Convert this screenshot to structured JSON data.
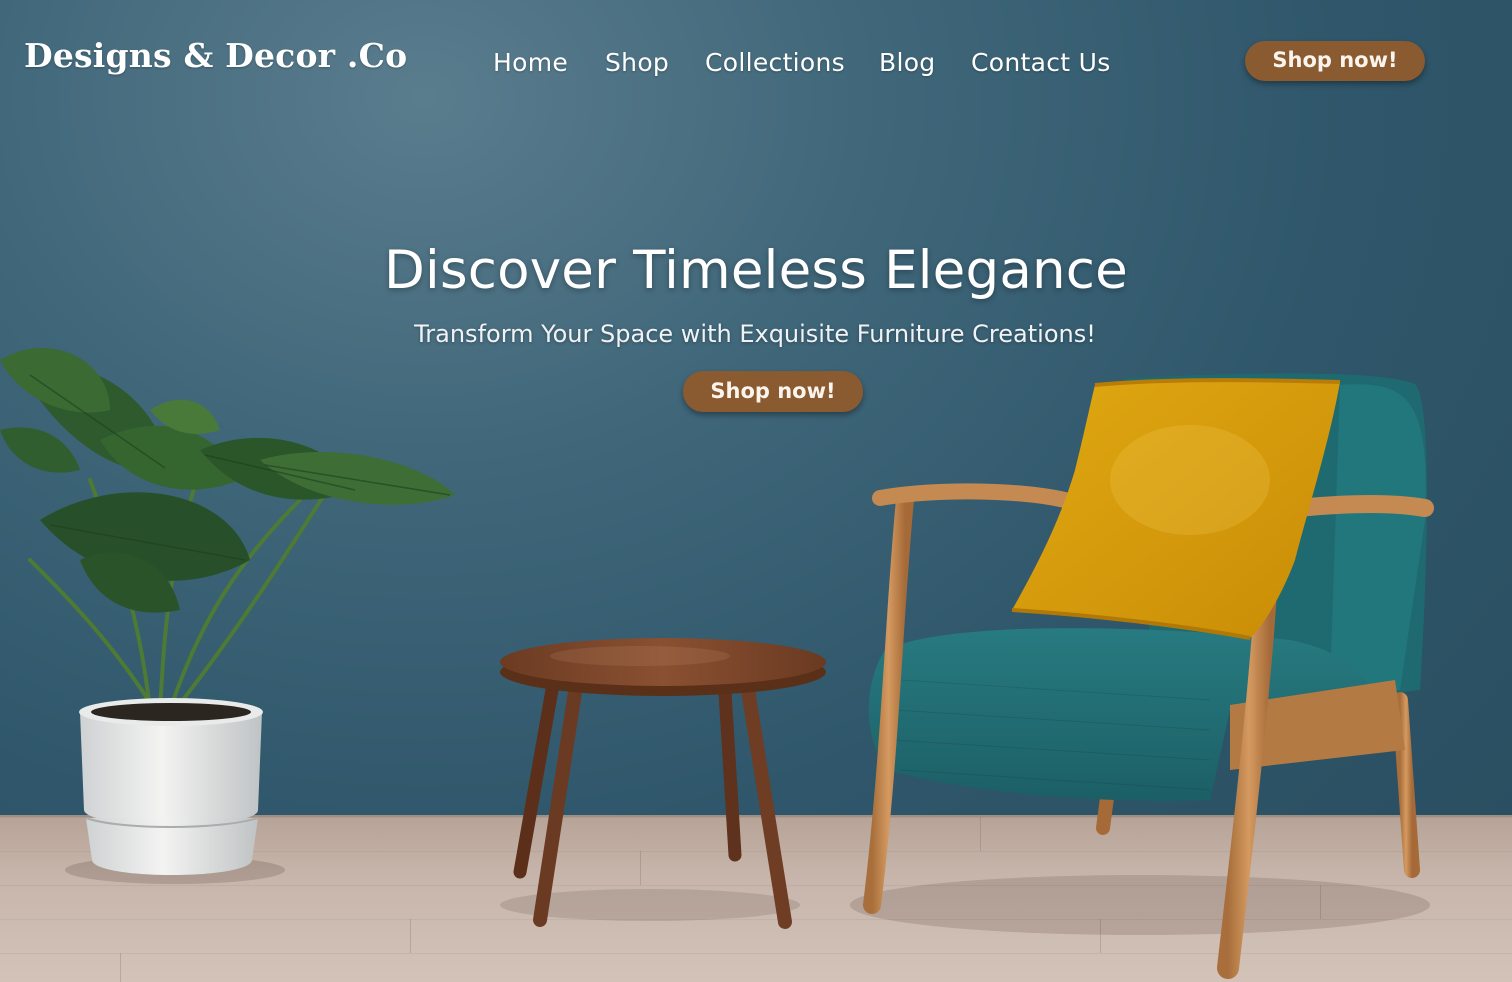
{
  "header": {
    "logo": "Designs & Decor .Co",
    "nav": [
      "Home",
      "Shop",
      "Collections",
      "Blog",
      "Contact Us"
    ],
    "cta_label": "Shop now!"
  },
  "hero": {
    "title": "Discover Timeless Elegance",
    "subtitle": "Transform Your Space with Exquisite Furniture Creations!",
    "cta_label": "Shop now!"
  },
  "colors": {
    "wall": "#2f566a",
    "button": "#8a5a30",
    "floor": "#c7b5ab",
    "armchair_upholstery": "#1f6a70",
    "cushion": "#d79d0a",
    "wood": "#c48a52"
  },
  "scene_items": [
    "monstera-plant",
    "white-planter",
    "round-side-table",
    "armchair",
    "yellow-cushion"
  ]
}
